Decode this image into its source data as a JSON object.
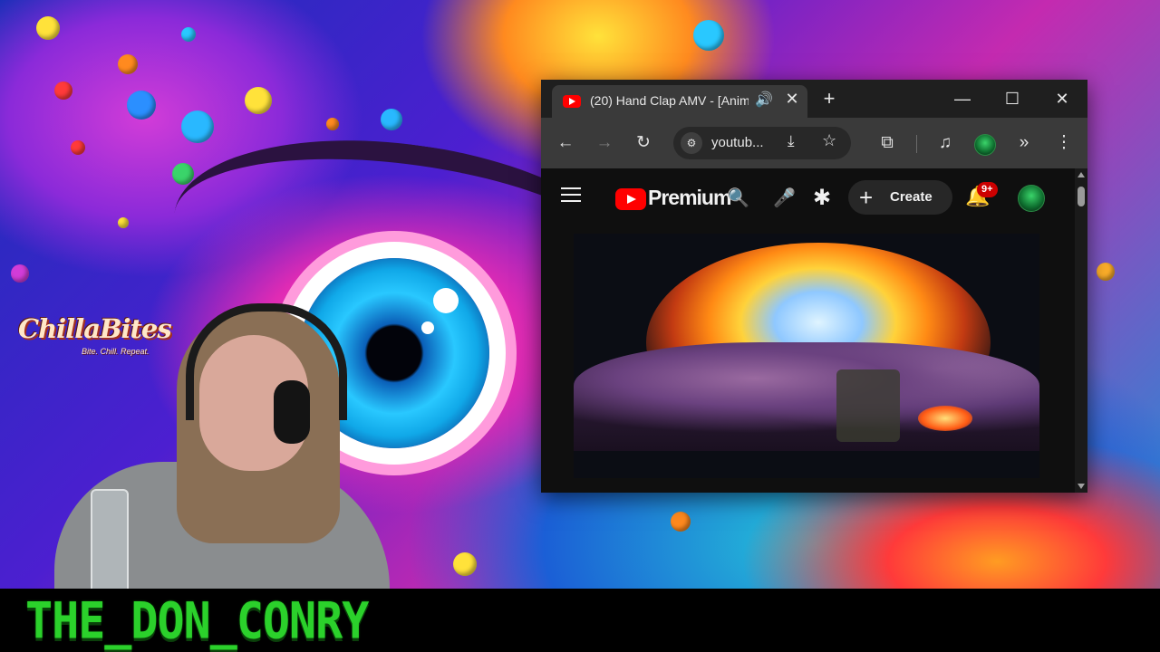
{
  "overlay": {
    "logo_text": "ChillaBites",
    "logo_tagline": "Bite. Chill. Repeat.",
    "streamer_name": "THE_DON_CONRY"
  },
  "browser": {
    "tab": {
      "title": "(20) Hand Clap AMV - [Anim",
      "favicon": "youtube-favicon-icon",
      "audio_icon": "🔊",
      "close_glyph": "✕"
    },
    "newtab_glyph": "+",
    "window_controls": {
      "minimize": "—",
      "maximize": "☐",
      "close": "✕"
    },
    "toolbar": {
      "back": "←",
      "forward": "→",
      "reload": "↻",
      "url": "youtub...",
      "site_info": "⚙",
      "install": "⤓",
      "bookmark": "☆",
      "extensions": "⧉",
      "media": "♫",
      "more_tools": "»",
      "menu": "⋮"
    }
  },
  "youtube": {
    "brand": "Premium",
    "search_glyph": "🔍",
    "mic_glyph": "🎤",
    "create_plus": "+",
    "create_label": "Create",
    "bell_glyph": "🔔",
    "notifications_badge": "9+"
  },
  "colors": {
    "youtube_red": "#ff0000",
    "badge_red": "#cc0000",
    "name_green": "#2bd12b",
    "browser_toolbar": "#3a3a3a",
    "browser_tabstrip": "#1f1f1f"
  }
}
